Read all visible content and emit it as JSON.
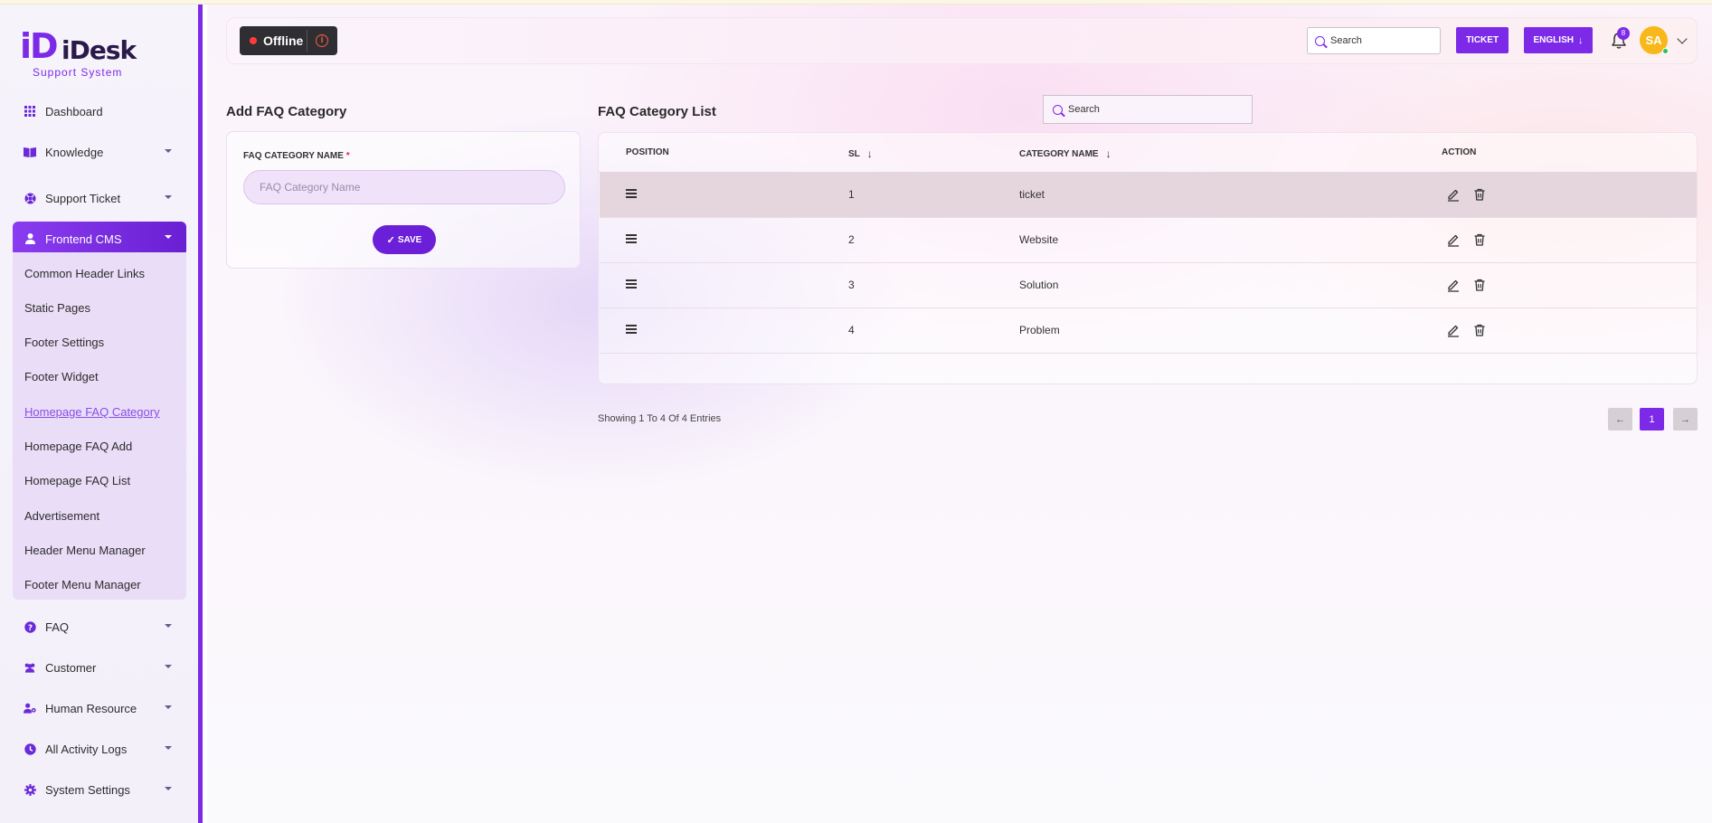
{
  "app": {
    "logo_mark": "iD",
    "logo_name": "iDesk",
    "logo_tagline": "Support System"
  },
  "sidebar": {
    "items": [
      {
        "label": "Dashboard",
        "icon": "grid-icon"
      },
      {
        "label": "Knowledge",
        "icon": "book-icon"
      },
      {
        "label": "Support Ticket",
        "icon": "lifebuoy-icon"
      },
      {
        "label": "Frontend CMS",
        "icon": "user-icon"
      },
      {
        "label": "FAQ",
        "icon": "question-circle-icon"
      },
      {
        "label": "Customer",
        "icon": "users-icon"
      },
      {
        "label": "Human Resource",
        "icon": "user-gear-icon"
      },
      {
        "label": "All Activity Logs",
        "icon": "clock-icon"
      },
      {
        "label": "System Settings",
        "icon": "gear-icon"
      }
    ],
    "submenu": [
      "Common Header Links",
      "Static Pages",
      "Footer Settings",
      "Footer Widget",
      "Homepage FAQ Category",
      "Homepage FAQ Add",
      "Homepage FAQ List",
      "Advertisement",
      "Header Menu Manager",
      "Footer Menu Manager"
    ]
  },
  "header": {
    "status": "Offline",
    "search_placeholder": "Search",
    "ticket_label": "TICKET",
    "language_label": "ENGLISH",
    "notification_count": "8",
    "avatar_initials": "SA"
  },
  "add_form": {
    "title": "Add FAQ Category",
    "field_label": "FAQ CATEGORY NAME",
    "required_mark": "*",
    "placeholder": "FAQ Category Name",
    "save_label": "SAVE"
  },
  "list": {
    "title": "FAQ Category List",
    "search_placeholder": "Search",
    "columns": {
      "position": "POSITION",
      "sl": "SL",
      "category_name": "CATEGORY NAME",
      "action": "ACTION"
    },
    "rows": [
      {
        "sl": "1",
        "name": "ticket"
      },
      {
        "sl": "2",
        "name": "Website"
      },
      {
        "sl": "3",
        "name": "Solution"
      },
      {
        "sl": "4",
        "name": "Problem"
      }
    ],
    "entries_text": "Showing 1 To 4 Of 4 Entries",
    "current_page": "1"
  },
  "colors": {
    "accent": "#7c2ae8",
    "offline_dot": "#ff3b3b",
    "avatar_bg": "#f8b81b",
    "online_dot": "#23c35a"
  }
}
